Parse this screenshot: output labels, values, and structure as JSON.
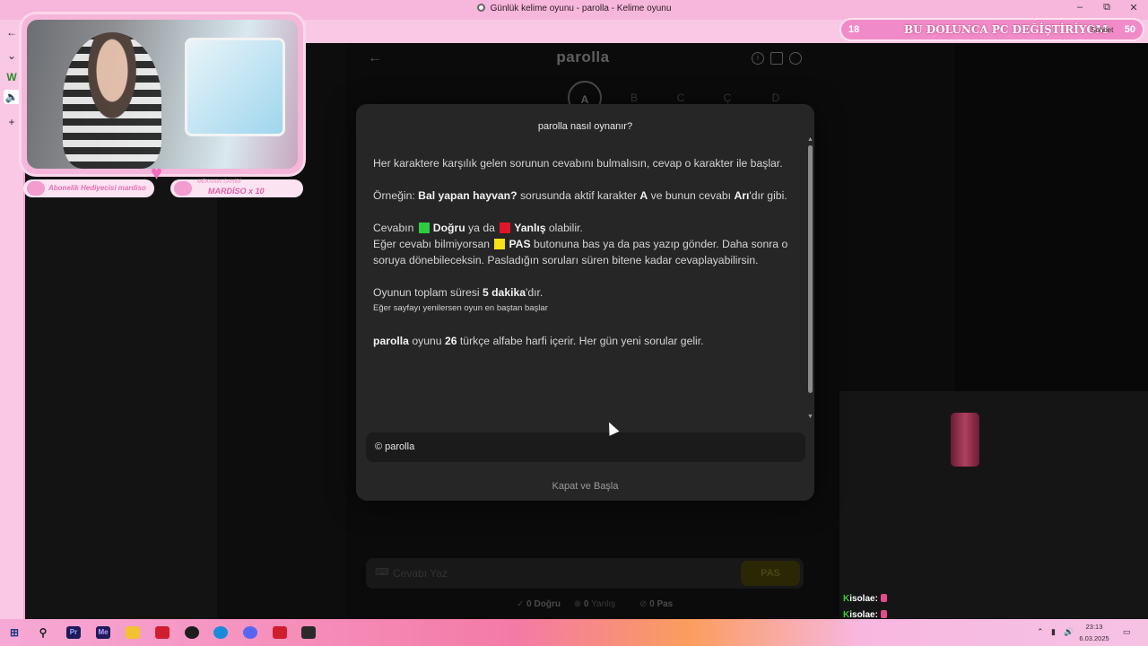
{
  "window": {
    "title": "Günlük kelime oyunu - parolla - Kelime oyunu",
    "minimize": "–",
    "maximize": "⧉",
    "close": "✕"
  },
  "app": {
    "logo": "parolla",
    "back_icon": "←",
    "letters": [
      "A",
      "B",
      "C",
      "Ç",
      "D"
    ],
    "answer_placeholder": "Cevabı Yaz",
    "pas_label": "PAS",
    "stats": {
      "correct_count": "0",
      "correct_label": "Doğru",
      "wrong_count": "0",
      "wrong_label": "Yanlış",
      "pas_count": "0",
      "pas_label": "Pas"
    }
  },
  "modal": {
    "title": "parolla nasıl oynanır?",
    "p1": "Her karaktere karşılık gelen sorunun cevabını bulmalısın, cevap o karakter ile başlar.",
    "p2_a": "Örneğin: ",
    "p2_b": "Bal yapan hayvan?",
    "p2_c": " sorusunda aktif karakter ",
    "p2_d": "A",
    "p2_e": " ve bunun cevabı ",
    "p2_f": "Arı",
    "p2_g": "'dır gibi.",
    "p3_a": "Cevabın ",
    "p3_b": "Doğru",
    "p3_c": " ya da ",
    "p3_d": "Yanlış",
    "p3_e": " olabilir.",
    "p3_f": "Eğer cevabı bilmiyorsan ",
    "p3_g": "PAS",
    "p3_h": " butonuna bas ya da pas yazıp gönder. Daha sonra o soruya dönebileceksin. Pasladığın soruları süren bitene kadar cevaplayabilirsin.",
    "p4_a": "Oyunun toplam süresi ",
    "p4_b": "5 dakika",
    "p4_c": "'dır.",
    "p4_small": "Eğer sayfayı yenilersen oyun en baştan başlar",
    "p5_a": "parolla",
    "p5_b": " oyunu ",
    "p5_c": "26",
    "p5_d": " türkçe alfabe harfi içerir. Her gün yeni sorular gelir.",
    "footer": "© parolla",
    "close_button": "Kapat ve Başla",
    "colors": {
      "green": "#2ecc40",
      "red": "#e0162b",
      "yellow": "#f5e21a"
    }
  },
  "overlay": {
    "sub_gift": "Abonelik Hediyecisi mardiso",
    "owner_label": "MEKANIN SAHİBİ",
    "owner_value": "MARDİSO x 10",
    "goal_start": "18",
    "goal_text": "BU DOLUNCA PC DEĞİŞTİRİYOM",
    "goal_end": "50",
    "sohbet": "Sohbet",
    "chat": [
      {
        "user": "isolae:"
      },
      {
        "user": "isolae:"
      }
    ]
  },
  "taskbar": {
    "apps": [
      "Pr",
      "Me"
    ],
    "time": "23:13",
    "date": "6.03.2025"
  }
}
